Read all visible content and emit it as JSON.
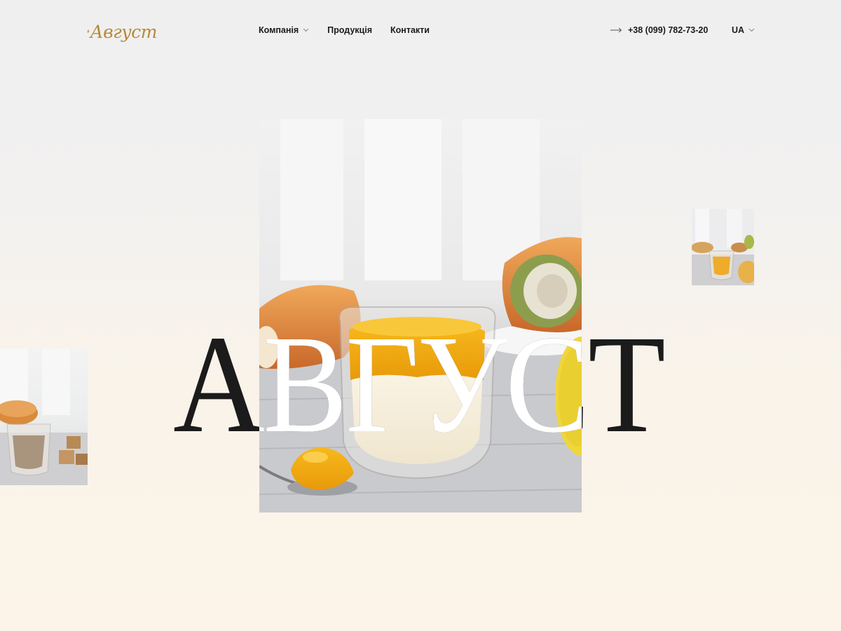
{
  "header": {
    "logo_text": "Август",
    "nav": [
      {
        "label": "Компанія",
        "has_dropdown": true
      },
      {
        "label": "Продукція",
        "has_dropdown": false
      },
      {
        "label": "Контакти",
        "has_dropdown": false
      }
    ],
    "phone": "+38 (099) 782-73-20",
    "phone_icon": "arrow-right-icon",
    "language": "UA"
  },
  "hero": {
    "title": "АВГУСТ"
  },
  "colors": {
    "brand_gold": "#b88a3a",
    "text_dark": "#1b1b1b",
    "jelly_orange": "#f2a713",
    "background_top": "#efeff0",
    "background_bottom": "#fcf4e8"
  }
}
